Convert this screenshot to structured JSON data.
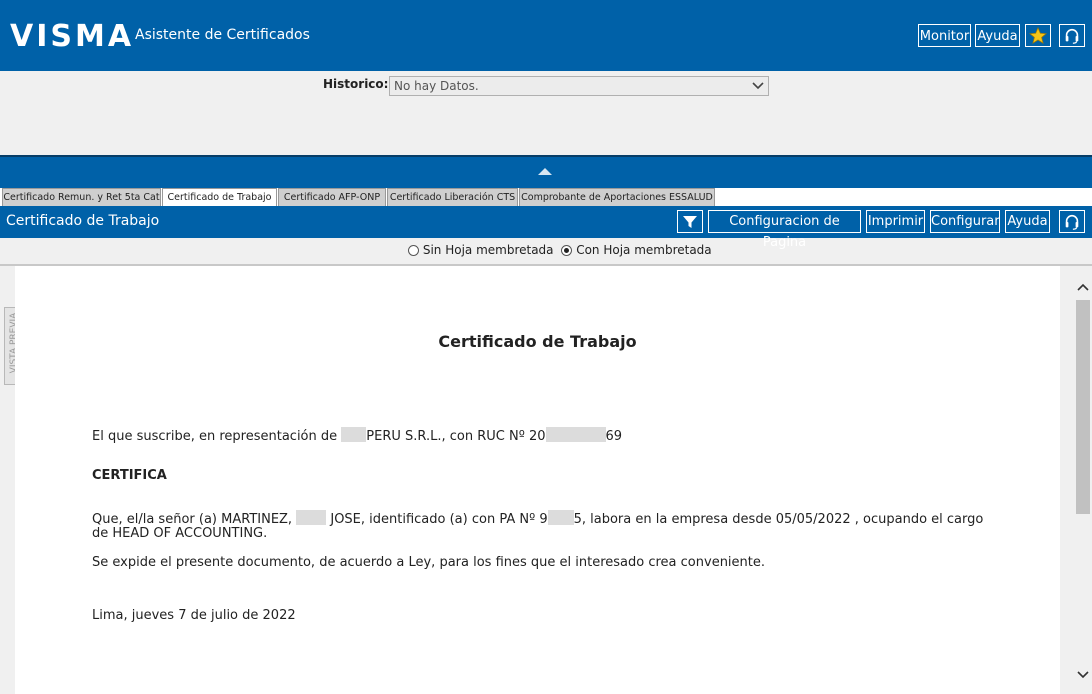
{
  "app": {
    "logo": "VISMA",
    "title": "Asistente de Certificados"
  },
  "topbar": {
    "monitor": "Monitor",
    "ayuda": "Ayuda",
    "star_icon": "star-icon",
    "headset_icon": "headset-icon"
  },
  "historico": {
    "label": "Historico:",
    "value": "No hay Datos."
  },
  "tabs": [
    "Certificado Remun. y Ret 5ta Cat",
    "Certificado de Trabajo",
    "Certificado AFP-ONP",
    "Certificado Liberación CTS",
    "Comprobante de Aportaciones ESSALUD"
  ],
  "section": {
    "title": "Certificado de Trabajo",
    "filter_icon": "filter-icon",
    "config_pagina": "Configuracion de Pagina",
    "imprimir": "Imprimir",
    "configurar": "Configurar",
    "ayuda": "Ayuda"
  },
  "options": {
    "sin_hoja": "Sin Hoja membretada",
    "con_hoja": "Con Hoja membretada",
    "selected": "con_hoja"
  },
  "side_tab": "VISTA PREVIA",
  "document": {
    "title": "Certificado de Trabajo",
    "l1a": "El que suscribe, en representación de",
    "l1b": "PERU S.R.L., con RUC Nº 20",
    "l1c": "69",
    "certifica": "CERTIFICA",
    "l2a": "Que, el/la señor (a) MARTINEZ,",
    "l2b": "JOSE, identificado (a) con PA Nº 9",
    "l2c": "5, labora en la empresa desde 05/05/2022 , ocupando el cargo",
    "l2d": "de HEAD OF ACCOUNTING.",
    "l3": "Se expide el presente documento, de acuerdo a Ley, para los fines que el interesado crea conveniente.",
    "fecha": "Lima, jueves 7 de julio de 2022"
  }
}
